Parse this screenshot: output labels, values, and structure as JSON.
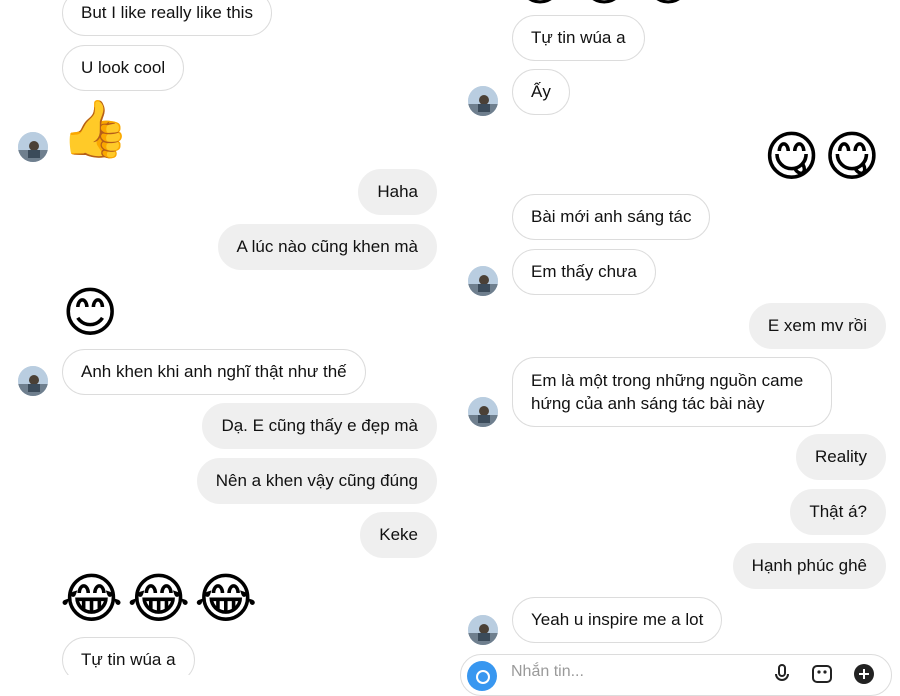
{
  "left_panel": {
    "messages": [
      {
        "kind": "in",
        "text": "But I like really like this"
      },
      {
        "kind": "in",
        "text": "U look cool"
      },
      {
        "kind": "emoji",
        "text": "👍"
      },
      {
        "kind": "out",
        "text": "Haha"
      },
      {
        "kind": "out",
        "text": "A lúc nào cũng khen mà"
      },
      {
        "kind": "emoji",
        "text": "😊"
      },
      {
        "kind": "in",
        "text": "Anh khen khi anh nghĩ thật như thế"
      },
      {
        "kind": "out",
        "text": "Dạ. E cũng thấy e đẹp mà"
      },
      {
        "kind": "out",
        "text": "Nên a khen vậy cũng đúng"
      },
      {
        "kind": "out",
        "text": "Keke"
      },
      {
        "kind": "emoji",
        "text": "😂😂😂"
      },
      {
        "kind": "in",
        "text": "Tự tin wúa a"
      }
    ]
  },
  "right_panel": {
    "messages": [
      {
        "kind": "emoji",
        "text": "😂😂😂"
      },
      {
        "kind": "in",
        "text": "Tự tin wúa a"
      },
      {
        "kind": "in",
        "text": "Ấy"
      },
      {
        "kind": "emoji",
        "text": "😋😋"
      },
      {
        "kind": "in",
        "text": "Bài mới anh sáng tác"
      },
      {
        "kind": "in",
        "text": "Em thấy chưa"
      },
      {
        "kind": "out",
        "text": "E xem mv rồi"
      },
      {
        "kind": "in",
        "text": "Em là một trong những nguồn came hứng của anh sáng tác bài này"
      },
      {
        "kind": "out",
        "text": "Reality"
      },
      {
        "kind": "out",
        "text": "Thật á?"
      },
      {
        "kind": "out",
        "text": "Hạnh phúc ghê"
      },
      {
        "kind": "in",
        "text": "Yeah u inspire me a lot"
      }
    ]
  },
  "composer": {
    "placeholder": "Nhắn tin...",
    "icons": [
      "camera-icon",
      "microphone-icon",
      "image-icon",
      "sticker-icon"
    ]
  },
  "colors": {
    "outgoing_bubble": "#efefef",
    "incoming_border": "#dcdcdc",
    "camera_button": "#3897f0"
  }
}
